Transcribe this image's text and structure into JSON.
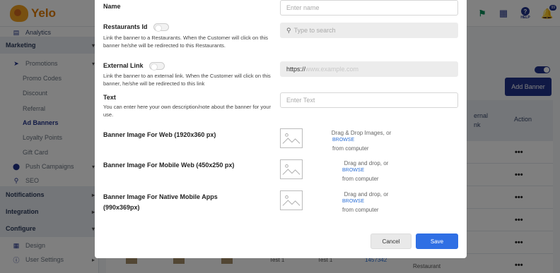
{
  "app": {
    "logo_text": "Yelo",
    "top_icons": [
      "flag-icon",
      "grid-icon",
      "help-icon",
      "bell-icon"
    ],
    "help_label": "HELP",
    "notification_count": "99",
    "accent_color": "#21328a"
  },
  "sidebar": {
    "items": [
      {
        "label": "Analytics",
        "type": "sub"
      },
      {
        "label": "Marketing",
        "type": "section"
      },
      {
        "label": "Promotions",
        "type": "sub"
      },
      {
        "label": "Promo Codes",
        "type": "subsub"
      },
      {
        "label": "Discount",
        "type": "subsub"
      },
      {
        "label": "Referral",
        "type": "subsub"
      },
      {
        "label": "Ad Banners",
        "type": "subsub",
        "active": true
      },
      {
        "label": "Loyalty Points",
        "type": "subsub"
      },
      {
        "label": "Gift Card",
        "type": "subsub"
      },
      {
        "label": "Push Campaigns",
        "type": "sub"
      },
      {
        "label": "SEO",
        "type": "sub"
      },
      {
        "label": "Notifications",
        "type": "section"
      },
      {
        "label": "Integration",
        "type": "section"
      },
      {
        "label": "Configure",
        "type": "section"
      },
      {
        "label": "Design",
        "type": "sub"
      },
      {
        "label": "User Settings",
        "type": "sub"
      }
    ]
  },
  "page": {
    "add_button": "Add Banner",
    "table_headers": {
      "external_link": "ernal\nnk",
      "action": "Action"
    },
    "row_action": "•••",
    "last_row": {
      "col1": "Test 1",
      "col2": "Test 1",
      "col3": "1457342",
      "col4": "Restaurant"
    }
  },
  "modal": {
    "name_label": "Name",
    "name_placeholder": "Enter name",
    "restaurants_label": "Restaurants Id",
    "restaurants_help": "Link the banner to a Restaurants. When the Customer will click on this banner he/she will be redirected to this Restaurants.",
    "search_placeholder": "Type to search",
    "external_label": "External Link",
    "external_help": "Link the banner to an external link. When the Customer will click on this banner, he/she will be redirected to this link",
    "url_prefix": "https://",
    "url_placeholder": "www.example.com",
    "text_label": "Text",
    "text_help": "You can enter here your own description/note about the banner for your use.",
    "text_placeholder": "Enter Text",
    "web_image_label": "Banner Image For Web (1920x360 px)",
    "web_drop_text": "Drag & Drop Images, or",
    "mobile_web_label": "Banner Image For Mobile Web (450x250 px)",
    "native_label": "Banner Image For Native Mobile Apps (990x369px)",
    "drop_text": "Drag and drop, or",
    "browse": "BROWSE",
    "from_computer": "from computer",
    "cancel": "Cancel",
    "save": "Save"
  }
}
